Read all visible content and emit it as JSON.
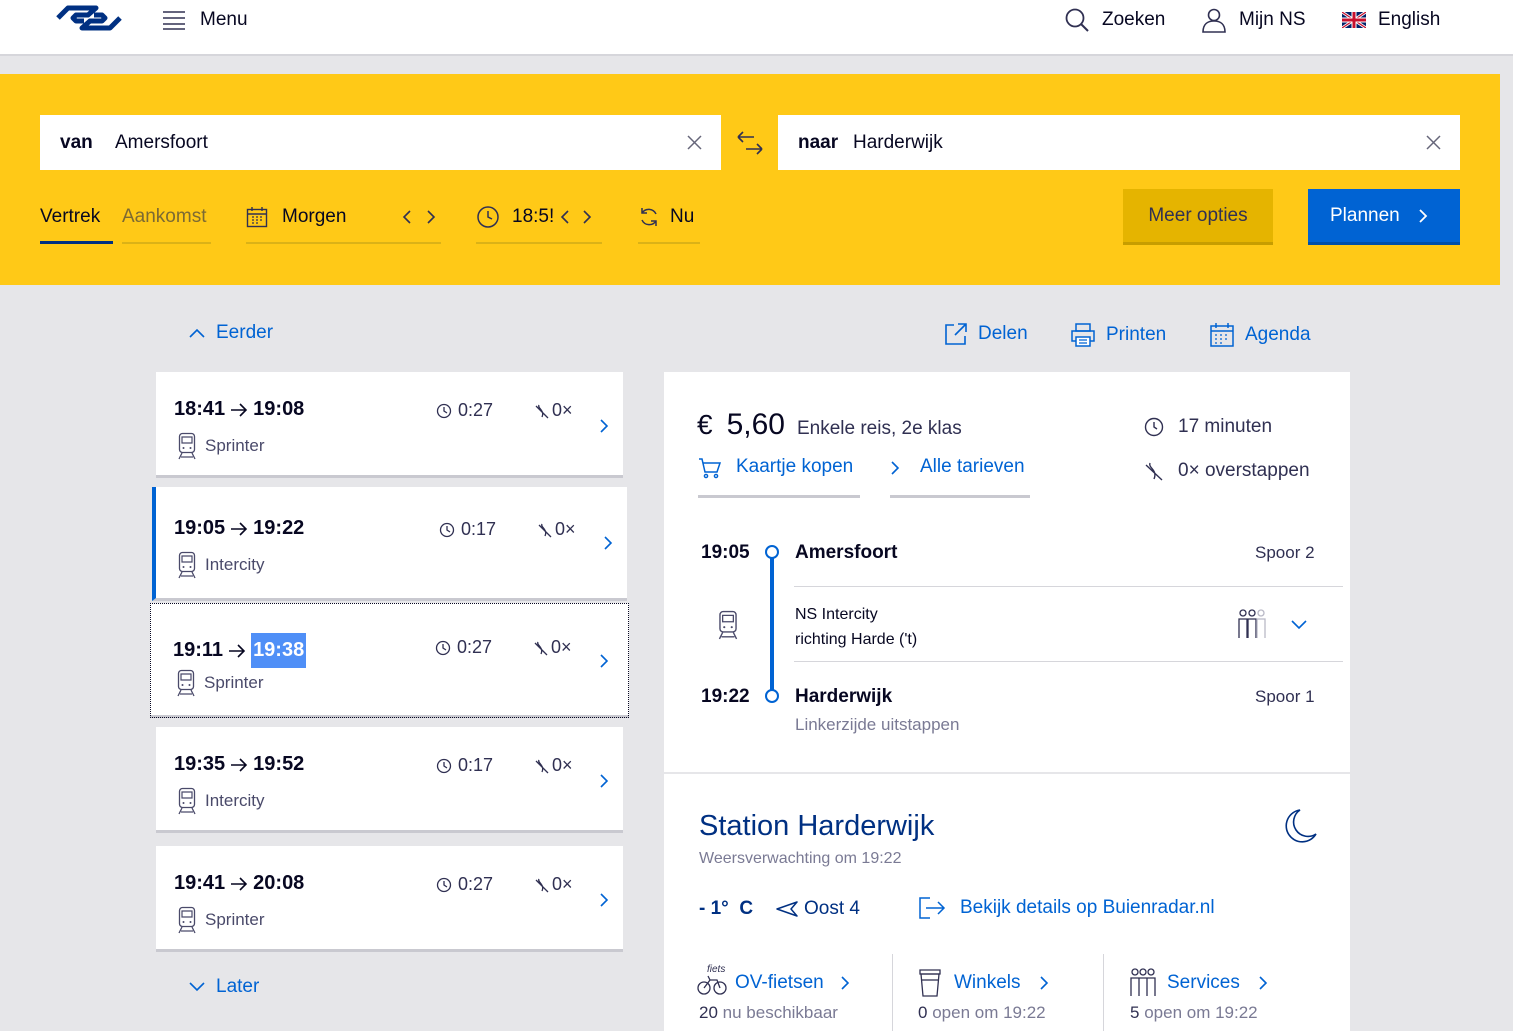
{
  "header": {
    "menu_label": "Menu",
    "search_label": "Zoeken",
    "account_label": "Mijn NS",
    "language_label": "English",
    "brand_color": "#003082"
  },
  "planner": {
    "from_label": "van",
    "from_value": "Amersfoort",
    "to_label": "naar",
    "to_value": "Harderwijk",
    "tab_departure": "Vertrek",
    "tab_arrival": "Aankomst",
    "date_value": "Morgen",
    "time_value": "18:5!",
    "now_label": "Nu",
    "more_options": "Meer opties",
    "plan_button": "Plannen",
    "accent_color": "#ffc917"
  },
  "actions": {
    "earlier": "Eerder",
    "later": "Later",
    "share": "Delen",
    "print": "Printen",
    "calendar": "Agenda"
  },
  "trips": [
    {
      "dep": "18:41",
      "arr": "19:08",
      "duration": "0:27",
      "changes": "0×",
      "type": "Sprinter"
    },
    {
      "dep": "19:05",
      "arr": "19:22",
      "duration": "0:17",
      "changes": "0×",
      "type": "Intercity"
    },
    {
      "dep": "19:11",
      "arr": "19:38",
      "duration": "0:27",
      "changes": "0×",
      "type": "Sprinter"
    },
    {
      "dep": "19:35",
      "arr": "19:52",
      "duration": "0:17",
      "changes": "0×",
      "type": "Intercity"
    },
    {
      "dep": "19:41",
      "arr": "20:08",
      "duration": "0:27",
      "changes": "0×",
      "type": "Sprinter"
    }
  ],
  "detail": {
    "currency": "€",
    "price": "5,60",
    "fare_desc": "Enkele reis, 2e klas",
    "duration": "17 minuten",
    "changes": "0× overstappen",
    "buy_ticket": "Kaartje kopen",
    "all_fares": "Alle tarieven",
    "dep_time": "19:05",
    "dep_station": "Amersfoort",
    "dep_platform": "Spoor 2",
    "train_line1": "NS Intercity",
    "train_line2": "richting Harde ('t)",
    "arr_time": "19:22",
    "arr_station": "Harderwijk",
    "arr_platform": "Spoor 1",
    "arr_note": "Linkerzijde uitstappen"
  },
  "station": {
    "title": "Station Harderwijk",
    "forecast": "Weersverwachting om 19:22",
    "temperature": "- 1°  C",
    "wind": "Oost 4",
    "buienradar": "Bekijk details op Buienradar.nl",
    "bike_label": "OV-fietsen",
    "bike_count": "20",
    "bike_status": "nu beschikbaar",
    "bike_icon_text": "fiets",
    "shops_label": "Winkels",
    "shops_count": "0",
    "shops_status": "open om 19:22",
    "services_label": "Services",
    "services_count": "5",
    "services_status": "open om 19:22"
  }
}
